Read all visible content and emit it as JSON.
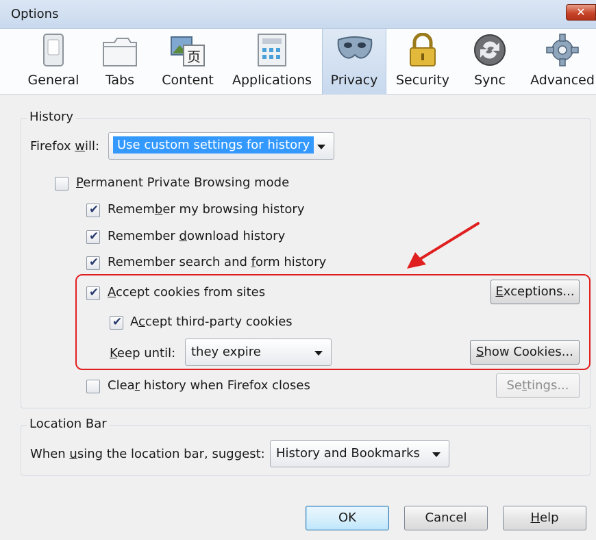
{
  "window": {
    "title": "Options",
    "close": "✕"
  },
  "toolbar": {
    "items": [
      {
        "label": "General",
        "icon": "switch-icon"
      },
      {
        "label": "Tabs",
        "icon": "tabs-icon"
      },
      {
        "label": "Content",
        "icon": "content-icon"
      },
      {
        "label": "Applications",
        "icon": "applications-icon"
      },
      {
        "label": "Privacy",
        "icon": "mask-icon",
        "active": true
      },
      {
        "label": "Security",
        "icon": "padlock-icon"
      },
      {
        "label": "Sync",
        "icon": "sync-icon"
      },
      {
        "label": "Advanced",
        "icon": "gear-icon"
      }
    ],
    "content_glyph": "页"
  },
  "history": {
    "title": "History",
    "firefox_will_pre": "Firefox ",
    "firefox_will_u": "w",
    "firefox_will_post": "ill:",
    "mode_value": "Use custom settings for history",
    "permanent_pre": "",
    "permanent_u": "P",
    "permanent_post": "ermanent Private Browsing mode",
    "remember_browsing_pre": "Remem",
    "remember_browsing_u": "b",
    "remember_browsing_post": "er my browsing history",
    "remember_download_pre": "Remember ",
    "remember_download_u": "d",
    "remember_download_post": "ownload history",
    "remember_search_pre": "Remember search and ",
    "remember_search_u": "f",
    "remember_search_post": "orm history",
    "accept_cookies_pre": "",
    "accept_cookies_u": "A",
    "accept_cookies_post": "ccept cookies from sites",
    "third_party_pre": "A",
    "third_party_u": "c",
    "third_party_post": "cept third-party cookies",
    "keep_until_pre": "",
    "keep_until_u": "K",
    "keep_until_post": "eep until:",
    "keep_until_value": "they expire",
    "clear_pre": "Clea",
    "clear_u": "r",
    "clear_post": " history when Firefox closes",
    "exceptions_pre": "",
    "exceptions_u": "E",
    "exceptions_post": "xceptions...",
    "show_cookies_pre": "",
    "show_cookies_u": "S",
    "show_cookies_post": "how Cookies...",
    "settings_pre": "Se",
    "settings_u": "t",
    "settings_post": "tings...",
    "checks": {
      "permanent": false,
      "browsing": true,
      "download": true,
      "search": true,
      "accept": true,
      "third_party": true,
      "clear": false
    },
    "check_glyph": "✔"
  },
  "location_bar": {
    "title": "Location Bar",
    "suggest_pre": "When ",
    "suggest_u": "u",
    "suggest_post": "sing the location bar, suggest:",
    "suggest_value": "History and Bookmarks"
  },
  "footer": {
    "ok": "OK",
    "cancel": "Cancel",
    "help_pre": "",
    "help_u": "H",
    "help_post": "elp"
  },
  "colors": {
    "highlight": "#e02020",
    "selection": "#3399ff",
    "active_tab": "#c8d9ee"
  }
}
